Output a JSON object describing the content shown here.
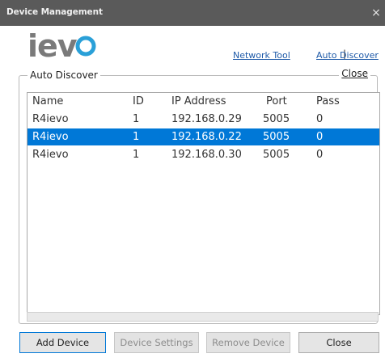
{
  "window": {
    "title": "Device Management",
    "close_glyph": "×"
  },
  "logo": {
    "text": "ievo",
    "color": "#7a7a7a",
    "accent": "#2aa0d8"
  },
  "links": {
    "network_tool": "Network Tool",
    "separator": "|",
    "auto_discover": "Auto Discover"
  },
  "group": {
    "title": "Auto Discover",
    "close_label": "Close"
  },
  "table": {
    "columns": [
      "Name",
      "ID",
      "IP Address",
      "Port",
      "Pass"
    ],
    "rows": [
      {
        "name": "R4ievo",
        "id": "1",
        "ip": "192.168.0.29",
        "port": "5005",
        "pass": "0"
      },
      {
        "name": "R4ievo",
        "id": "1",
        "ip": "192.168.0.22",
        "port": "5005",
        "pass": "0"
      },
      {
        "name": "R4ievo",
        "id": "1",
        "ip": "192.168.0.30",
        "port": "5005",
        "pass": "0"
      }
    ],
    "selected_index": 1,
    "selection_color": "#0078d7"
  },
  "buttons": {
    "add_device": "Add Device",
    "device_settings": "Device Settings",
    "remove_device": "Remove Device",
    "close": "Close"
  }
}
